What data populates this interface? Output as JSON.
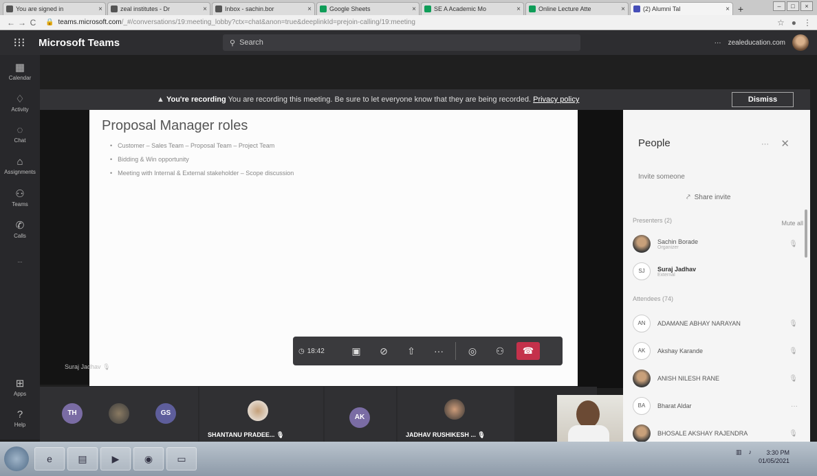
{
  "browser": {
    "tabs": [
      {
        "label": "You are signed in",
        "active": false
      },
      {
        "label": "zeal institutes - Dr",
        "active": false
      },
      {
        "label": "Inbox - sachin.bor",
        "active": false
      },
      {
        "label": "Google Sheets",
        "active": false
      },
      {
        "label": "SE A Academic Mo",
        "active": false
      },
      {
        "label": "Online Lecture Atte",
        "active": false
      },
      {
        "label": "(2) Alumni Tal",
        "active": true
      }
    ],
    "url_host": "teams.microsoft.com",
    "url_path": "/_#/conversations/19:meeting_lobby?ctx=chat&anon=true&deeplinkId=prejoin-calling/19:meeting"
  },
  "teams": {
    "app_title": "Microsoft Teams",
    "search_placeholder": "Search",
    "account": "zealeducation.com"
  },
  "rail": [
    {
      "label": "Calendar",
      "icon": "calendar-icon"
    },
    {
      "label": "Activity",
      "icon": "bell-icon"
    },
    {
      "label": "Chat",
      "icon": "chat-icon"
    },
    {
      "label": "Assignments",
      "icon": "assignments-icon"
    },
    {
      "label": "Teams",
      "icon": "teams-icon"
    },
    {
      "label": "Calls",
      "icon": "phone-icon"
    },
    {
      "label": "...",
      "icon": "more-icon"
    }
  ],
  "rail_bottom": [
    {
      "label": "Apps",
      "icon": "apps-icon"
    },
    {
      "label": "Help",
      "icon": "help-icon"
    }
  ],
  "banner": {
    "bold": "You're recording",
    "message": "You are recording this meeting. Be sure to let everyone know that they are being recorded.",
    "link": "Privacy policy",
    "dismiss": "Dismiss"
  },
  "slide": {
    "title": "Proposal Manager roles",
    "bullets": [
      "Customer – Sales Team – Proposal Team – Project Team",
      "Bidding & Win opportunity",
      "Meeting with Internal & External stakeholder – Scope discussion"
    ]
  },
  "presenter": {
    "name": "Suraj Jadhav"
  },
  "controls": {
    "timer": "18:42"
  },
  "tiles": [
    {
      "initials": "TH",
      "name": ""
    },
    {
      "initials": "",
      "name": ""
    },
    {
      "initials": "GS",
      "name": ""
    },
    {
      "initials": "",
      "name": "SHANTANU PRADEE..."
    },
    {
      "initials": "AK",
      "name": ""
    },
    {
      "initials": "",
      "name": "JADHAV RUSHIKESH ..."
    }
  ],
  "people": {
    "title": "People",
    "invite": "Invite someone",
    "share": "Share invite",
    "presenters_label": "Presenters (2)",
    "mute_all": "Mute all",
    "presenters": [
      {
        "initials": "",
        "name": "Sachin Borade",
        "role": "Organizer"
      },
      {
        "initials": "SJ",
        "name": "Suraj Jadhav",
        "role": "External"
      }
    ],
    "attendees_label": "Attendees (74)",
    "attendees": [
      {
        "initials": "AN",
        "name": "ADAMANE ABHAY NARAYAN"
      },
      {
        "initials": "AK",
        "name": "Akshay Karande"
      },
      {
        "initials": "",
        "name": "ANISH NILESH RANE"
      },
      {
        "initials": "BA",
        "name": "Bharat Aldar"
      },
      {
        "initials": "",
        "name": "BHOSALE AKSHAY RAJENDRA"
      }
    ]
  },
  "taskbar": {
    "time": "3:30 PM",
    "date": "01/05/2021"
  }
}
